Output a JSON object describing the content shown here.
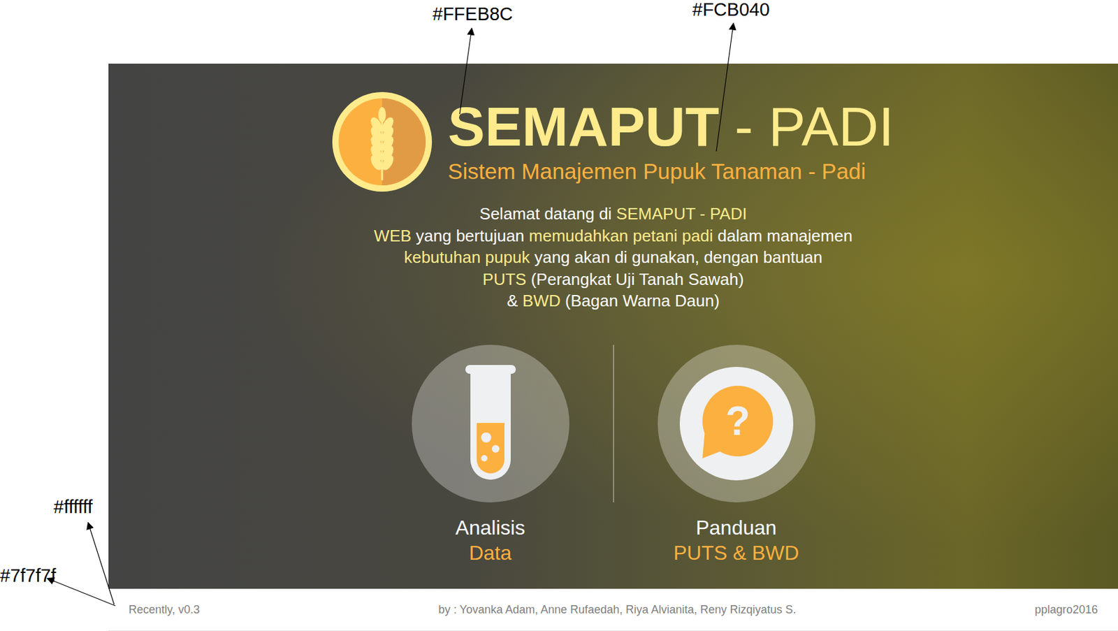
{
  "annotations": [
    {
      "label": "#FFEB8C"
    },
    {
      "label": "#FCB040"
    },
    {
      "label": "#ffffff"
    },
    {
      "label": "#7f7f7f"
    }
  ],
  "header": {
    "title": "SEMAPUT",
    "title_suffix": " - PADI",
    "subtitle": "Sistem Manajemen Pupuk Tanaman - Padi"
  },
  "intro": [
    [
      {
        "text": "Selamat datang di ",
        "highlight": false
      },
      {
        "text": "SEMAPUT - PADI",
        "highlight": true
      }
    ],
    [
      {
        "text": "WEB",
        "highlight": true
      },
      {
        "text": " yang bertujuan ",
        "highlight": false
      },
      {
        "text": "memudahkan petani padi",
        "highlight": true
      },
      {
        "text": " dalam manajemen",
        "highlight": false
      }
    ],
    [
      {
        "text": "kebutuhan pupuk",
        "highlight": true
      },
      {
        "text": " yang akan di gunakan, dengan bantuan",
        "highlight": false
      }
    ],
    [
      {
        "text": "PUTS",
        "highlight": true
      },
      {
        "text": " (Perangkat Uji Tanah Sawah)",
        "highlight": false
      }
    ],
    [
      {
        "text": "& ",
        "highlight": false
      },
      {
        "text": "BWD",
        "highlight": true
      },
      {
        "text": " (Bagan Warna Daun)",
        "highlight": false
      }
    ]
  ],
  "menu": [
    {
      "kind": "tube",
      "label": "Analisis",
      "sublabel": "Data",
      "glyph": ""
    },
    {
      "kind": "help",
      "label": "Panduan",
      "sublabel": "PUTS & BWD",
      "glyph": "?"
    }
  ],
  "footer": {
    "version": "Recently, v0.3",
    "credits": "by : Yovanka Adam, Anne Rufaedah, Riya Alvianita, Reny Rizqiyatus S.",
    "copyright": "pplagro2016"
  }
}
